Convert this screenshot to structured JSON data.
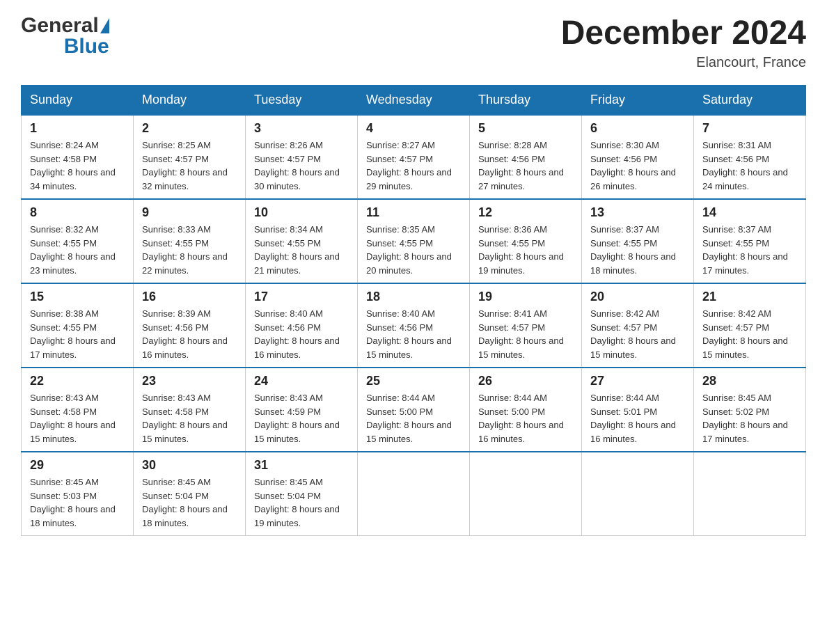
{
  "header": {
    "logo_general": "General",
    "logo_blue": "Blue",
    "month_title": "December 2024",
    "location": "Elancourt, France"
  },
  "weekdays": [
    "Sunday",
    "Monday",
    "Tuesday",
    "Wednesday",
    "Thursday",
    "Friday",
    "Saturday"
  ],
  "weeks": [
    [
      {
        "day": "1",
        "sunrise": "Sunrise: 8:24 AM",
        "sunset": "Sunset: 4:58 PM",
        "daylight": "Daylight: 8 hours and 34 minutes."
      },
      {
        "day": "2",
        "sunrise": "Sunrise: 8:25 AM",
        "sunset": "Sunset: 4:57 PM",
        "daylight": "Daylight: 8 hours and 32 minutes."
      },
      {
        "day": "3",
        "sunrise": "Sunrise: 8:26 AM",
        "sunset": "Sunset: 4:57 PM",
        "daylight": "Daylight: 8 hours and 30 minutes."
      },
      {
        "day": "4",
        "sunrise": "Sunrise: 8:27 AM",
        "sunset": "Sunset: 4:57 PM",
        "daylight": "Daylight: 8 hours and 29 minutes."
      },
      {
        "day": "5",
        "sunrise": "Sunrise: 8:28 AM",
        "sunset": "Sunset: 4:56 PM",
        "daylight": "Daylight: 8 hours and 27 minutes."
      },
      {
        "day": "6",
        "sunrise": "Sunrise: 8:30 AM",
        "sunset": "Sunset: 4:56 PM",
        "daylight": "Daylight: 8 hours and 26 minutes."
      },
      {
        "day": "7",
        "sunrise": "Sunrise: 8:31 AM",
        "sunset": "Sunset: 4:56 PM",
        "daylight": "Daylight: 8 hours and 24 minutes."
      }
    ],
    [
      {
        "day": "8",
        "sunrise": "Sunrise: 8:32 AM",
        "sunset": "Sunset: 4:55 PM",
        "daylight": "Daylight: 8 hours and 23 minutes."
      },
      {
        "day": "9",
        "sunrise": "Sunrise: 8:33 AM",
        "sunset": "Sunset: 4:55 PM",
        "daylight": "Daylight: 8 hours and 22 minutes."
      },
      {
        "day": "10",
        "sunrise": "Sunrise: 8:34 AM",
        "sunset": "Sunset: 4:55 PM",
        "daylight": "Daylight: 8 hours and 21 minutes."
      },
      {
        "day": "11",
        "sunrise": "Sunrise: 8:35 AM",
        "sunset": "Sunset: 4:55 PM",
        "daylight": "Daylight: 8 hours and 20 minutes."
      },
      {
        "day": "12",
        "sunrise": "Sunrise: 8:36 AM",
        "sunset": "Sunset: 4:55 PM",
        "daylight": "Daylight: 8 hours and 19 minutes."
      },
      {
        "day": "13",
        "sunrise": "Sunrise: 8:37 AM",
        "sunset": "Sunset: 4:55 PM",
        "daylight": "Daylight: 8 hours and 18 minutes."
      },
      {
        "day": "14",
        "sunrise": "Sunrise: 8:37 AM",
        "sunset": "Sunset: 4:55 PM",
        "daylight": "Daylight: 8 hours and 17 minutes."
      }
    ],
    [
      {
        "day": "15",
        "sunrise": "Sunrise: 8:38 AM",
        "sunset": "Sunset: 4:55 PM",
        "daylight": "Daylight: 8 hours and 17 minutes."
      },
      {
        "day": "16",
        "sunrise": "Sunrise: 8:39 AM",
        "sunset": "Sunset: 4:56 PM",
        "daylight": "Daylight: 8 hours and 16 minutes."
      },
      {
        "day": "17",
        "sunrise": "Sunrise: 8:40 AM",
        "sunset": "Sunset: 4:56 PM",
        "daylight": "Daylight: 8 hours and 16 minutes."
      },
      {
        "day": "18",
        "sunrise": "Sunrise: 8:40 AM",
        "sunset": "Sunset: 4:56 PM",
        "daylight": "Daylight: 8 hours and 15 minutes."
      },
      {
        "day": "19",
        "sunrise": "Sunrise: 8:41 AM",
        "sunset": "Sunset: 4:57 PM",
        "daylight": "Daylight: 8 hours and 15 minutes."
      },
      {
        "day": "20",
        "sunrise": "Sunrise: 8:42 AM",
        "sunset": "Sunset: 4:57 PM",
        "daylight": "Daylight: 8 hours and 15 minutes."
      },
      {
        "day": "21",
        "sunrise": "Sunrise: 8:42 AM",
        "sunset": "Sunset: 4:57 PM",
        "daylight": "Daylight: 8 hours and 15 minutes."
      }
    ],
    [
      {
        "day": "22",
        "sunrise": "Sunrise: 8:43 AM",
        "sunset": "Sunset: 4:58 PM",
        "daylight": "Daylight: 8 hours and 15 minutes."
      },
      {
        "day": "23",
        "sunrise": "Sunrise: 8:43 AM",
        "sunset": "Sunset: 4:58 PM",
        "daylight": "Daylight: 8 hours and 15 minutes."
      },
      {
        "day": "24",
        "sunrise": "Sunrise: 8:43 AM",
        "sunset": "Sunset: 4:59 PM",
        "daylight": "Daylight: 8 hours and 15 minutes."
      },
      {
        "day": "25",
        "sunrise": "Sunrise: 8:44 AM",
        "sunset": "Sunset: 5:00 PM",
        "daylight": "Daylight: 8 hours and 15 minutes."
      },
      {
        "day": "26",
        "sunrise": "Sunrise: 8:44 AM",
        "sunset": "Sunset: 5:00 PM",
        "daylight": "Daylight: 8 hours and 16 minutes."
      },
      {
        "day": "27",
        "sunrise": "Sunrise: 8:44 AM",
        "sunset": "Sunset: 5:01 PM",
        "daylight": "Daylight: 8 hours and 16 minutes."
      },
      {
        "day": "28",
        "sunrise": "Sunrise: 8:45 AM",
        "sunset": "Sunset: 5:02 PM",
        "daylight": "Daylight: 8 hours and 17 minutes."
      }
    ],
    [
      {
        "day": "29",
        "sunrise": "Sunrise: 8:45 AM",
        "sunset": "Sunset: 5:03 PM",
        "daylight": "Daylight: 8 hours and 18 minutes."
      },
      {
        "day": "30",
        "sunrise": "Sunrise: 8:45 AM",
        "sunset": "Sunset: 5:04 PM",
        "daylight": "Daylight: 8 hours and 18 minutes."
      },
      {
        "day": "31",
        "sunrise": "Sunrise: 8:45 AM",
        "sunset": "Sunset: 5:04 PM",
        "daylight": "Daylight: 8 hours and 19 minutes."
      },
      null,
      null,
      null,
      null
    ]
  ]
}
